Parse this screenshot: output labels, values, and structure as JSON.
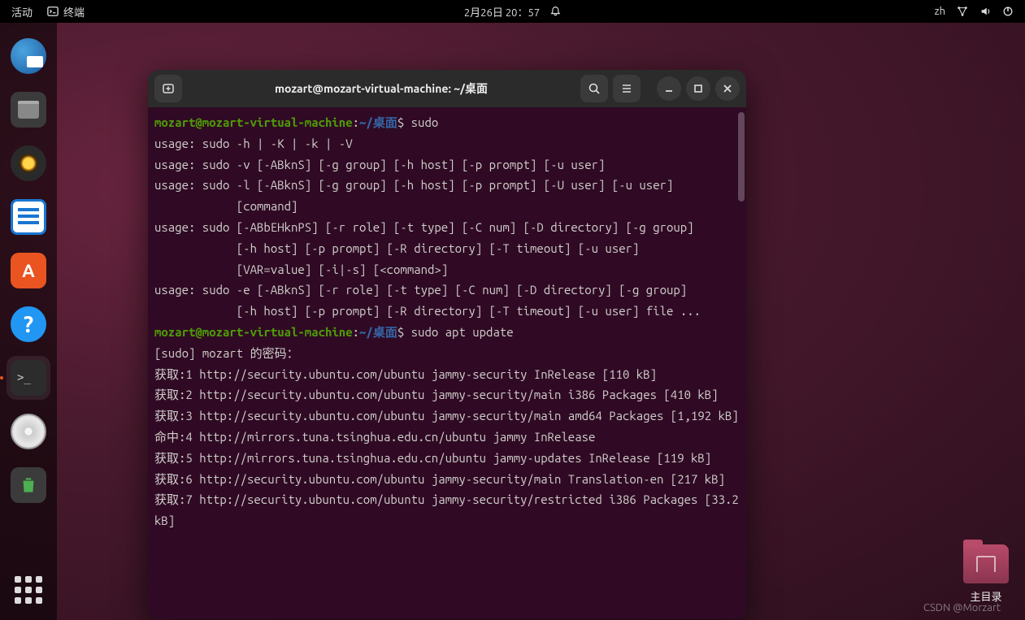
{
  "topbar": {
    "activities": "活动",
    "app_label": "终端",
    "datetime": "2月26日 20：57",
    "input_method": "zh"
  },
  "dock": {
    "items": [
      {
        "name": "thunderbird"
      },
      {
        "name": "files"
      },
      {
        "name": "rhythmbox"
      },
      {
        "name": "libreoffice-writer"
      },
      {
        "name": "ubuntu-software"
      },
      {
        "name": "help"
      },
      {
        "name": "terminal"
      },
      {
        "name": "disk"
      },
      {
        "name": "trash"
      }
    ]
  },
  "desktop": {
    "home_folder_label": "主目录"
  },
  "terminal": {
    "title": "mozart@mozart-virtual-machine: ~/桌面",
    "prompt": {
      "user_host": "mozart@mozart-virtual-machine",
      "path": "~/桌面",
      "symbol": "$"
    },
    "commands": {
      "c1": "sudo",
      "c2": "sudo apt update"
    },
    "output_lines": [
      "usage: sudo -h | -K | -k | -V",
      "usage: sudo -v [-ABknS] [-g group] [-h host] [-p prompt] [-u user]",
      "usage: sudo -l [-ABknS] [-g group] [-h host] [-p prompt] [-U user] [-u user]",
      "            [command]",
      "usage: sudo [-ABbEHknPS] [-r role] [-t type] [-C num] [-D directory] [-g group]",
      "            [-h host] [-p prompt] [-R directory] [-T timeout] [-u user]",
      "            [VAR=value] [-i|-s] [<command>]",
      "usage: sudo -e [-ABknS] [-r role] [-t type] [-C num] [-D directory] [-g group]",
      "            [-h host] [-p prompt] [-R directory] [-T timeout] [-u user] file ..."
    ],
    "sudo_prompt": "[sudo] mozart 的密码：",
    "apt_lines": [
      "获取:1 http://security.ubuntu.com/ubuntu jammy-security InRelease [110 kB]",
      "获取:2 http://security.ubuntu.com/ubuntu jammy-security/main i386 Packages [410 kB]",
      "获取:3 http://security.ubuntu.com/ubuntu jammy-security/main amd64 Packages [1,192 kB]",
      "命中:4 http://mirrors.tuna.tsinghua.edu.cn/ubuntu jammy InRelease",
      "获取:5 http://mirrors.tuna.tsinghua.edu.cn/ubuntu jammy-updates InRelease [119 kB]",
      "获取:6 http://security.ubuntu.com/ubuntu jammy-security/main Translation-en [217 kB]",
      "获取:7 http://security.ubuntu.com/ubuntu jammy-security/restricted i386 Packages [33.2 kB]"
    ]
  },
  "watermark": "CSDN @Morzart"
}
